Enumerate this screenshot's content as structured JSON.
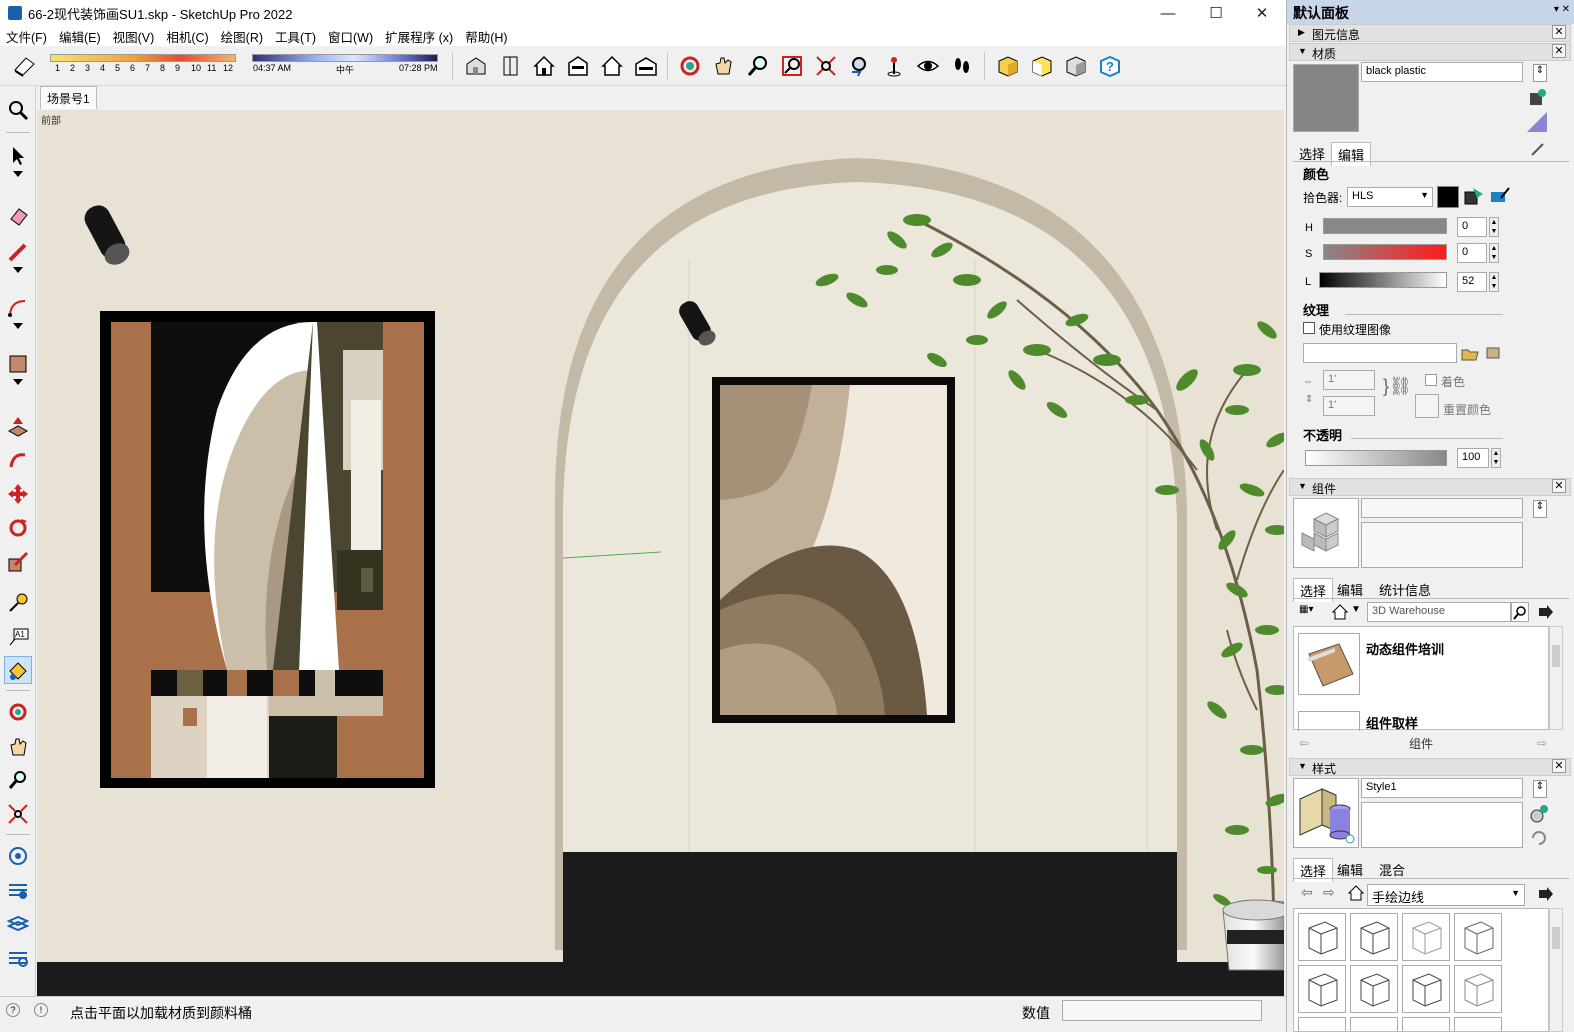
{
  "window": {
    "title": "66-2现代装饰画SU1.skp - SketchUp Pro 2022",
    "minimize": "—",
    "maximize": "☐",
    "close": "✕"
  },
  "menu": [
    "文件(F)",
    "编辑(E)",
    "视图(V)",
    "相机(C)",
    "绘图(R)",
    "工具(T)",
    "窗口(W)",
    "扩展程序 (x)",
    "帮助(H)"
  ],
  "toolbar": {
    "months": [
      "1",
      "2",
      "3",
      "4",
      "5",
      "6",
      "7",
      "8",
      "9",
      "10",
      "11",
      "12"
    ],
    "time_start": "04:37 AM",
    "time_mid": "中午",
    "time_end": "07:28 PM"
  },
  "scene_tab": "场景号1",
  "viewport": {
    "view_label": "前部"
  },
  "status": {
    "message": "点击平面以加载材质到颜料桶",
    "vcb_label": "数值",
    "vcb_value": ""
  },
  "panel": {
    "title": "默认面板",
    "entity_info": "图元信息",
    "materials": {
      "header": "材质",
      "name": "black plastic",
      "tab_select": "选择",
      "tab_edit": "编辑",
      "color_heading": "颜色",
      "picker_label": "拾色器:",
      "picker_value": "HLS",
      "h_label": "H",
      "h_value": "0",
      "s_label": "S",
      "s_value": "0",
      "l_label": "L",
      "l_value": "52",
      "texture_heading": "纹理",
      "use_texture": "使用纹理图像",
      "width_value": "1'",
      "height_value": "1'",
      "colorize": "着色",
      "reset_color": "重置颜色",
      "opacity_heading": "不透明",
      "opacity_value": "100"
    },
    "components": {
      "header": "组件",
      "tab_select": "选择",
      "tab_edit": "编辑",
      "tab_stats": "统计信息",
      "search_placeholder": "3D Warehouse",
      "items": [
        "动态组件培训",
        "组件取样"
      ],
      "nav_label": "组件"
    },
    "styles": {
      "header": "样式",
      "name": "Style1",
      "tab_select": "选择",
      "tab_edit": "编辑",
      "tab_mix": "混合",
      "collection": "手绘边线"
    }
  },
  "colors": {
    "wall": "#e8e2d4",
    "floor": "#1b1b1b",
    "accent": "#c7d6e9"
  }
}
